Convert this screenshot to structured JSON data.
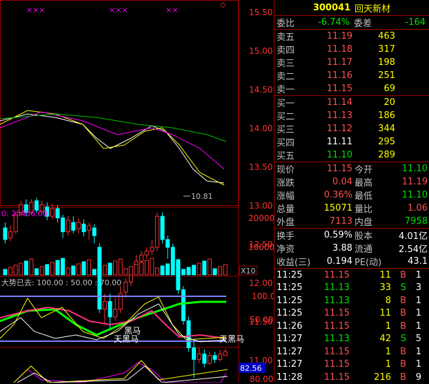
{
  "quote_header": {
    "code": "300041",
    "name": "回天新材"
  },
  "commission": {
    "ratio_label": "委比",
    "ratio_value": "-6.74%",
    "diff_label": "委差",
    "diff_value": "-164"
  },
  "asks": [
    {
      "label": "卖五",
      "price": "11.19",
      "volume": "463"
    },
    {
      "label": "卖四",
      "price": "11.18",
      "volume": "317"
    },
    {
      "label": "卖三",
      "price": "11.17",
      "volume": "198"
    },
    {
      "label": "卖二",
      "price": "11.16",
      "volume": "251"
    },
    {
      "label": "卖一",
      "price": "11.15",
      "volume": "69"
    }
  ],
  "bids": [
    {
      "label": "买一",
      "price": "11.14",
      "volume": "20"
    },
    {
      "label": "买二",
      "price": "11.13",
      "volume": "186"
    },
    {
      "label": "买三",
      "price": "11.12",
      "volume": "344"
    },
    {
      "label": "买四",
      "price": "11.11",
      "volume": "295"
    },
    {
      "label": "买五",
      "price": "11.10",
      "volume": "289"
    }
  ],
  "stats": [
    {
      "l1": "现价",
      "v1": "11.15",
      "c1": "r",
      "l2": "今开",
      "v2": "11.10",
      "c2": "g"
    },
    {
      "l1": "涨跌",
      "v1": "0.04",
      "c1": "r",
      "l2": "最高",
      "v2": "11.19",
      "c2": "r"
    },
    {
      "l1": "涨幅",
      "v1": "0.36%",
      "c1": "r",
      "l2": "最低",
      "v2": "11.10",
      "c2": "g"
    },
    {
      "l1": "总量",
      "v1": "15071",
      "c1": "y",
      "l2": "量比",
      "v2": "1.06",
      "c2": "r"
    },
    {
      "l1": "外盘",
      "v1": "7113",
      "c1": "r",
      "l2": "内盘",
      "v2": "7958",
      "c2": "g"
    }
  ],
  "fundamentals": [
    {
      "l1": "换手",
      "v1": "0.59%",
      "l2": "股本",
      "v2": "4.01亿"
    },
    {
      "l1": "净资",
      "v1": "3.88",
      "l2": "流通",
      "v2": "2.54亿"
    },
    {
      "l1": "收益(三)",
      "v1": "0.194",
      "l2": "PE(动)",
      "v2": "43.1"
    }
  ],
  "trades": [
    {
      "time": "11:25",
      "price": "11.15",
      "vol": "11",
      "side": "B",
      "n": "1"
    },
    {
      "time": "11:25",
      "price": "11.13",
      "vol": "33",
      "side": "S",
      "n": "3"
    },
    {
      "time": "11:25",
      "price": "11.13",
      "vol": "8",
      "side": "B",
      "n": "1"
    },
    {
      "time": "11:25",
      "price": "11.15",
      "vol": "11",
      "side": "B",
      "n": "1"
    },
    {
      "time": "11:26",
      "price": "11.15",
      "vol": "1",
      "side": "B",
      "n": "1"
    },
    {
      "time": "11:27",
      "price": "11.13",
      "vol": "42",
      "side": "S",
      "n": "5"
    },
    {
      "time": "11:27",
      "price": "11.15",
      "vol": "1",
      "side": "B",
      "n": "1"
    },
    {
      "time": "11:27",
      "price": "11.15",
      "vol": "1",
      "side": "B",
      "n": "1"
    },
    {
      "time": "11:28",
      "price": "11.15",
      "vol": "216",
      "side": "B",
      "n": "9"
    }
  ],
  "chart_data": {
    "type": "candlestick",
    "price_axis": [
      "15.50",
      "15.00",
      "14.50",
      "14.00",
      "13.50",
      "13.00",
      "12.50",
      "12.00",
      "11.50",
      "11.00"
    ],
    "low_marker": "10.81",
    "volume_label": "0: 25456.00",
    "volume_axis": [
      "20000",
      "10000"
    ],
    "volume_unit": "X10",
    "indicator_label": "大势已去: 100.00 : 50.00 : 70.00",
    "indicator_axis": [
      "100.0",
      "50.00"
    ],
    "indicator_annotations": [
      "黑马",
      "天黑马",
      "天黑马"
    ],
    "lower_value": "82.56",
    "lower_axis_partial": "80.00",
    "top_markers": [
      "×××",
      "×××",
      "××"
    ],
    "diamond_icon": "◇"
  },
  "colors": {
    "up": "#ff3030",
    "down": "#00ffff",
    "ma5": "#ffffff",
    "ma10": "#ffff00",
    "ma20": "#ff00ff",
    "ma60": "#00c000",
    "grid": "#a00000"
  }
}
